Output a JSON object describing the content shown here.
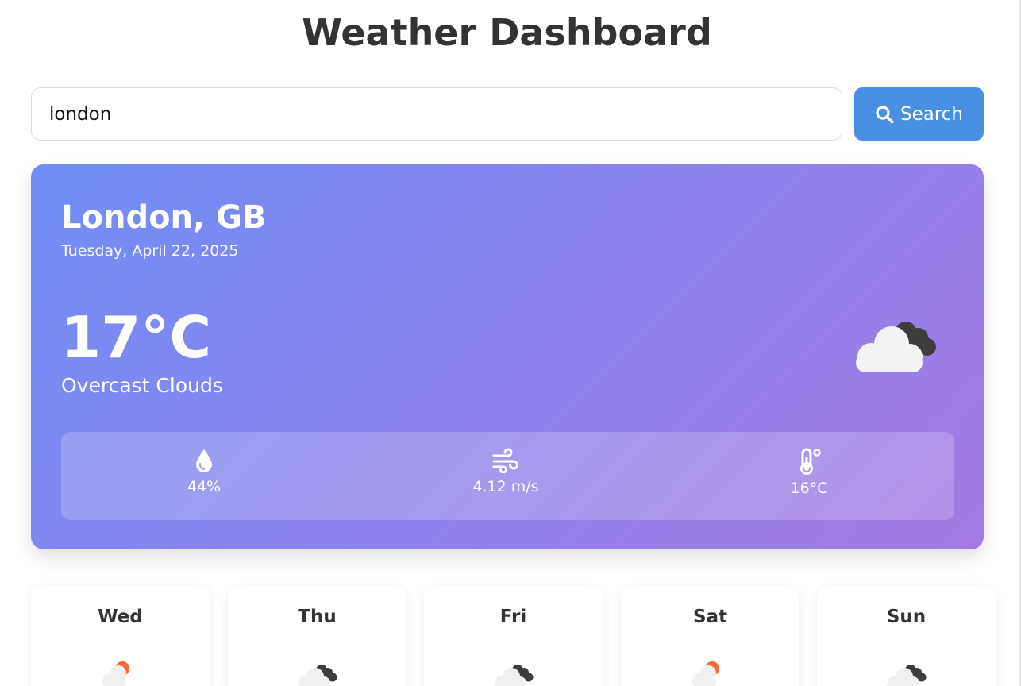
{
  "header": {
    "title": "Weather Dashboard"
  },
  "search": {
    "value": "london",
    "button_label": "Search",
    "button_icon": "search-icon",
    "accent_color": "#4a90e2"
  },
  "current": {
    "city": "London, GB",
    "date": "Tuesday, April 22, 2025",
    "temperature": "17°C",
    "condition": "Overcast Clouds",
    "icon": "overcast-clouds-icon",
    "stats": [
      {
        "icon": "humidity-icon",
        "value": "44%"
      },
      {
        "icon": "wind-icon",
        "value": "4.12 m/s"
      },
      {
        "icon": "feels-like-thermometer-icon",
        "value": "16°C"
      }
    ]
  },
  "forecast": [
    {
      "day": "Wed",
      "icon": "sun-cloud-rain-icon"
    },
    {
      "day": "Thu",
      "icon": "overcast-clouds-icon"
    },
    {
      "day": "Fri",
      "icon": "overcast-clouds-icon"
    },
    {
      "day": "Sat",
      "icon": "sun-cloud-rain-icon"
    },
    {
      "day": "Sun",
      "icon": "overcast-clouds-icon"
    }
  ]
}
